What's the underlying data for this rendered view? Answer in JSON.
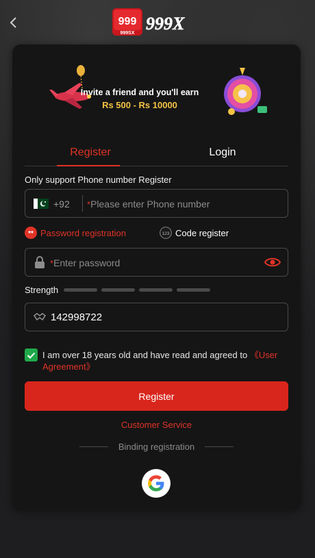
{
  "header": {
    "logo_badge": "999",
    "logo_sub": "999SX",
    "logo_wordmark": "999X",
    "back_icon": "chevron-left-icon"
  },
  "banner": {
    "line1": "Invite a friend and you'll earn",
    "line2": "Rs 500 - Rs 10000"
  },
  "tabs": [
    {
      "label": "Register",
      "active": true
    },
    {
      "label": "Login",
      "active": false
    }
  ],
  "form": {
    "support_text": "Only support Phone number Register",
    "phone": {
      "country_code": "+92",
      "required_mark": "*",
      "placeholder": "Please enter Phone number"
    },
    "modes": {
      "password_label": "Password registration",
      "code_label": "Code register",
      "code_icon_text": "123",
      "password_icon_text": "**"
    },
    "password": {
      "required_mark": "*",
      "placeholder": "Enter password"
    },
    "strength_label": "Strength",
    "strength_bars": 4,
    "captcha_value": "142998722",
    "agreement": {
      "checked": true,
      "text": "I am over 18 years old and have read and agreed to ",
      "link": "《User Agreement》"
    },
    "submit_label": "Register",
    "customer_service": "Customer Service",
    "binding_label": "Binding registration"
  },
  "colors": {
    "accent": "#e03327",
    "button": "#d9261c",
    "checkbox": "#1fa84a",
    "card": "#151515"
  }
}
